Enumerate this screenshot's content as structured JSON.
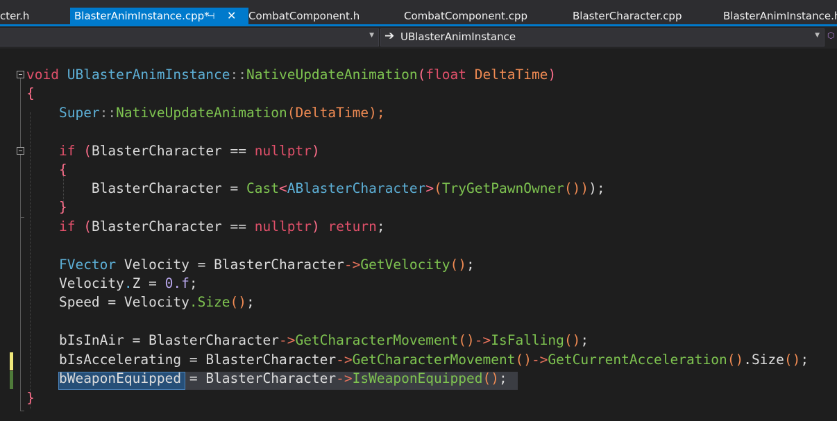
{
  "tabs": [
    {
      "label": "cter.h",
      "active": false
    },
    {
      "label": "BlasterAnimInstance.cpp*",
      "active": true
    },
    {
      "label": "CombatComponent.h",
      "active": false
    },
    {
      "label": "CombatComponent.cpp",
      "active": false
    },
    {
      "label": "BlasterCharacter.cpp",
      "active": false
    },
    {
      "label": "BlasterAnimInstance.h",
      "active": false
    }
  ],
  "tab_icons": {
    "pin": "pin-icon",
    "close": "close-icon"
  },
  "navbar": {
    "member_dropdown": "UBlasterAnimInstance",
    "member_icon": "class-navigation-arrow-icon"
  },
  "colors": {
    "accent": "#007acc",
    "keyword": "#e0506a",
    "type": "#5db0d7",
    "function": "#7ec350",
    "parameter": "#f08b53",
    "selection": "#264f78"
  },
  "code_lines": [
    "void UBlasterAnimInstance::NativeUpdateAnimation(float DeltaTime)",
    "{",
    "    Super::NativeUpdateAnimation(DeltaTime);",
    "",
    "    if (BlasterCharacter == nullptr)",
    "    {",
    "        BlasterCharacter = Cast<ABlasterCharacter>(TryGetPawnOwner());",
    "    }",
    "    if (BlasterCharacter == nullptr) return;",
    "",
    "    FVector Velocity = BlasterCharacter->GetVelocity();",
    "    Velocity.Z = 0.f;",
    "    Speed = Velocity.Size();",
    "",
    "    bIsInAir = BlasterCharacter->GetCharacterMovement()->IsFalling();",
    "    bIsAccelerating = BlasterCharacter->GetCharacterMovement()->GetCurrentAcceleration().Size();",
    "    bWeaponEquipped = BlasterCharacter->IsWeaponEquipped();",
    "}"
  ],
  "tokens": {
    "l0": [
      "void",
      " ",
      "UBlasterAnimInstance",
      "::",
      "NativeUpdateAnimation",
      "(",
      "float",
      " ",
      "DeltaTime",
      ")"
    ],
    "l1": [
      "{"
    ],
    "l2": [
      "    ",
      "Super",
      "::",
      "NativeUpdateAnimation",
      "(",
      "DeltaTime",
      ");"
    ],
    "l4": [
      "    ",
      "if",
      " ",
      "(",
      "BlasterCharacter",
      " == ",
      "nullptr",
      ")"
    ],
    "l5": [
      "    ",
      "{"
    ],
    "l6": [
      "        ",
      "BlasterCharacter",
      " = ",
      "Cast",
      "<",
      "ABlasterCharacter",
      ">",
      "(",
      "TryGetPawnOwner",
      "()",
      ")",
      ");"
    ],
    "l7": [
      "    ",
      "}"
    ],
    "l8": [
      "    ",
      "if",
      " ",
      "(",
      "BlasterCharacter",
      " == ",
      "nullptr",
      ")",
      " ",
      "return",
      ";"
    ],
    "l10": [
      "    ",
      "FVector",
      " ",
      "Velocity",
      " = ",
      "BlasterCharacter",
      "->",
      "GetVelocity",
      "()",
      ";"
    ],
    "l11": [
      "    ",
      "Velocity",
      ".",
      "Z",
      " = ",
      "0.f",
      ";"
    ],
    "l12": [
      "    ",
      "Speed",
      " = ",
      "Velocity",
      ".",
      "Size",
      "()",
      ";"
    ],
    "l14": [
      "    ",
      "bIsInAir",
      " = ",
      "BlasterCharacter",
      "->",
      "GetCharacterMovement",
      "()",
      "->",
      "IsFalling",
      "()",
      ";"
    ],
    "l15": [
      "    ",
      "bIsAccelerating",
      " = ",
      "BlasterCharacter",
      "->",
      "GetCharacterMovement",
      "()",
      "->",
      "GetCurrentAcceleration",
      "()",
      ".",
      "Size",
      "()",
      ";"
    ],
    "l16": [
      "    ",
      "bWeaponEquipped",
      " = ",
      "BlasterCharacter",
      "->",
      "IsWeaponEquipped",
      "()",
      ";"
    ],
    "l17": [
      "}"
    ]
  }
}
